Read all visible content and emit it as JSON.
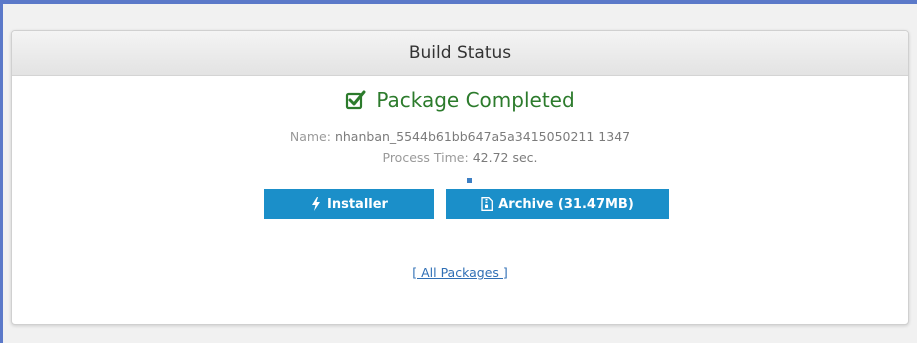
{
  "panel": {
    "title": "Build Status"
  },
  "status": {
    "text": "Package Completed",
    "icon": "check-square-icon",
    "color": "#2c7b2c"
  },
  "details": {
    "name_label": "Name:",
    "name_value": "nhanban_5544b61bb647a5a3415050211 1347",
    "time_label": "Process Time:",
    "time_value": "42.72 sec."
  },
  "buttons": {
    "installer_label": "Installer",
    "installer_icon": "bolt-icon",
    "archive_label": "Archive  (31.47MB)",
    "archive_icon": "file-archive-icon",
    "accent": "#1b8fc9"
  },
  "links": {
    "all_packages": "[ All Packages ]"
  }
}
